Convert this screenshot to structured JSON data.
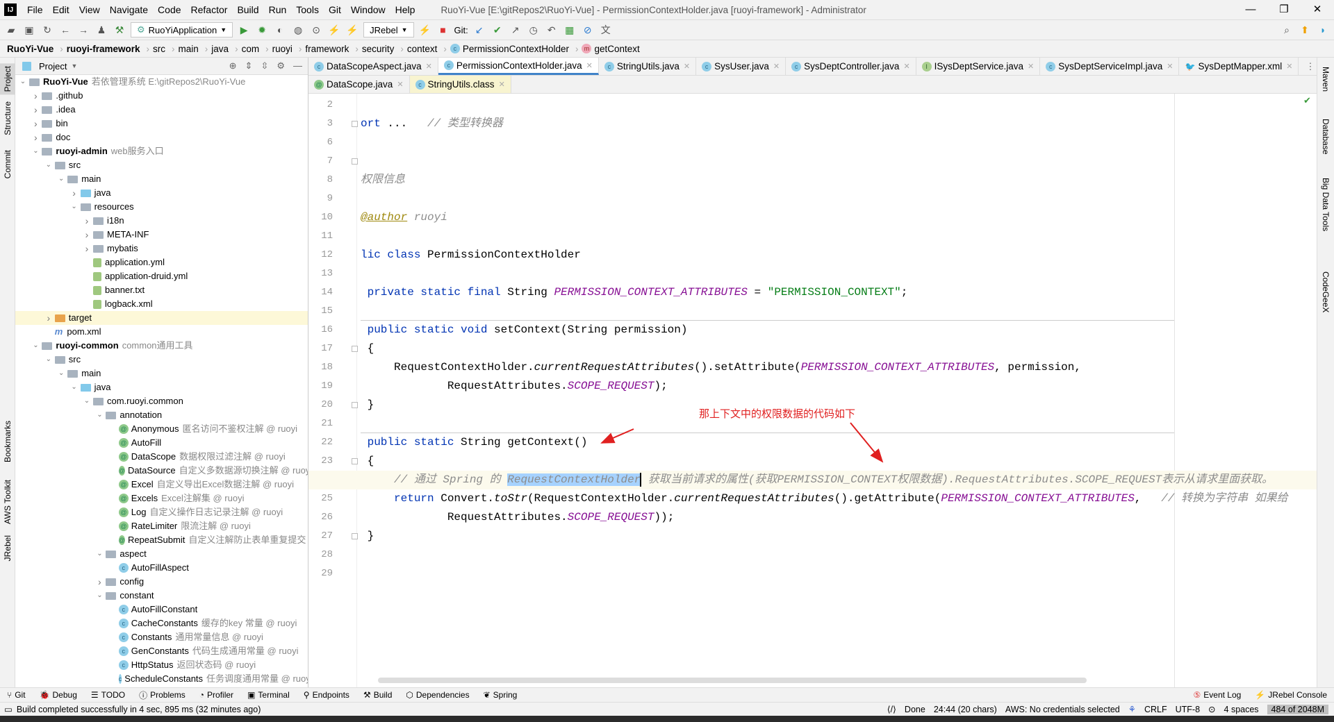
{
  "window": {
    "title": "RuoYi-Vue [E:\\gitRepos2\\RuoYi-Vue] - PermissionContextHolder.java [ruoyi-framework] - Administrator",
    "logo": "IJ",
    "controls": [
      "—",
      "❐",
      "✕"
    ]
  },
  "menu": [
    "File",
    "Edit",
    "View",
    "Navigate",
    "Code",
    "Refactor",
    "Build",
    "Run",
    "Tools",
    "Git",
    "Window",
    "Help"
  ],
  "toolbar": {
    "run_config": "RuoYiApplication",
    "jrebel": "JRebel",
    "git_label": "Git:"
  },
  "breadcrumb": [
    "RuoYi-Vue",
    "ruoyi-framework",
    "src",
    "main",
    "java",
    "com",
    "ruoyi",
    "framework",
    "security",
    "context",
    "PermissionContextHolder",
    "getContext"
  ],
  "left_stripe": [
    "Project",
    "Structure",
    "Commit",
    "Bookmarks",
    "AWS Toolkit",
    "JRebel"
  ],
  "right_stripe": [
    "Maven",
    "Database",
    "Big Data Tools",
    "CodeGeeX"
  ],
  "project": {
    "title": "Project",
    "tree": [
      {
        "l": 0,
        "a": "v",
        "i": "folder",
        "n": "RuoYi-Vue",
        "b": true,
        "h": "若依管理系统  E:\\gitRepos2\\RuoYi-Vue"
      },
      {
        "l": 1,
        "a": ">",
        "i": "folder",
        "n": ".github"
      },
      {
        "l": 1,
        "a": ">",
        "i": "folder",
        "n": ".idea"
      },
      {
        "l": 1,
        "a": ">",
        "i": "folder",
        "n": "bin"
      },
      {
        "l": 1,
        "a": ">",
        "i": "folder",
        "n": "doc"
      },
      {
        "l": 1,
        "a": "v",
        "i": "folder",
        "n": "ruoyi-admin",
        "b": true,
        "h": "web服务入口"
      },
      {
        "l": 2,
        "a": "v",
        "i": "folder",
        "n": "src"
      },
      {
        "l": 3,
        "a": "v",
        "i": "folder",
        "n": "main"
      },
      {
        "l": 4,
        "a": ">",
        "i": "blue",
        "n": "java"
      },
      {
        "l": 4,
        "a": "v",
        "i": "folder",
        "n": "resources"
      },
      {
        "l": 5,
        "a": ">",
        "i": "folder",
        "n": "i18n"
      },
      {
        "l": 5,
        "a": ">",
        "i": "folder",
        "n": "META-INF"
      },
      {
        "l": 5,
        "a": ">",
        "i": "folder",
        "n": "mybatis"
      },
      {
        "l": 5,
        "a": "",
        "i": "file",
        "n": "application.yml"
      },
      {
        "l": 5,
        "a": "",
        "i": "file",
        "n": "application-druid.yml"
      },
      {
        "l": 5,
        "a": "",
        "i": "file",
        "n": "banner.txt"
      },
      {
        "l": 5,
        "a": "",
        "i": "file",
        "n": "logback.xml"
      },
      {
        "l": 2,
        "a": ">",
        "i": "orange",
        "n": "target",
        "sel": true
      },
      {
        "l": 2,
        "a": "",
        "i": "m",
        "n": "pom.xml"
      },
      {
        "l": 1,
        "a": "v",
        "i": "folder",
        "n": "ruoyi-common",
        "b": true,
        "h": "common通用工具"
      },
      {
        "l": 2,
        "a": "v",
        "i": "folder",
        "n": "src"
      },
      {
        "l": 3,
        "a": "v",
        "i": "folder",
        "n": "main"
      },
      {
        "l": 4,
        "a": "v",
        "i": "blue",
        "n": "java"
      },
      {
        "l": 5,
        "a": "v",
        "i": "folder",
        "n": "com.ruoyi.common"
      },
      {
        "l": 6,
        "a": "v",
        "i": "folder",
        "n": "annotation"
      },
      {
        "l": 7,
        "a": "",
        "i": "@",
        "n": "Anonymous",
        "h": "匿名访问不鉴权注解 @ ruoyi"
      },
      {
        "l": 7,
        "a": "",
        "i": "@",
        "n": "AutoFill"
      },
      {
        "l": 7,
        "a": "",
        "i": "@",
        "n": "DataScope",
        "h": "数据权限过滤注解 @ ruoyi"
      },
      {
        "l": 7,
        "a": "",
        "i": "@",
        "n": "DataSource",
        "h": "自定义多数据源切换注解 @ ruoyi"
      },
      {
        "l": 7,
        "a": "",
        "i": "@",
        "n": "Excel",
        "h": "自定义导出Excel数据注解 @ ruoyi"
      },
      {
        "l": 7,
        "a": "",
        "i": "@",
        "n": "Excels",
        "h": "Excel注解集 @ ruoyi"
      },
      {
        "l": 7,
        "a": "",
        "i": "@",
        "n": "Log",
        "h": "自定义操作日志记录注解 @ ruoyi"
      },
      {
        "l": 7,
        "a": "",
        "i": "@",
        "n": "RateLimiter",
        "h": "限流注解 @ ruoyi"
      },
      {
        "l": 7,
        "a": "",
        "i": "@",
        "n": "RepeatSubmit",
        "h": "自定义注解防止表单重复提交 @"
      },
      {
        "l": 6,
        "a": "v",
        "i": "folder",
        "n": "aspect"
      },
      {
        "l": 7,
        "a": "",
        "i": "c",
        "n": "AutoFillAspect"
      },
      {
        "l": 6,
        "a": ">",
        "i": "folder",
        "n": "config"
      },
      {
        "l": 6,
        "a": "v",
        "i": "folder",
        "n": "constant"
      },
      {
        "l": 7,
        "a": "",
        "i": "c",
        "n": "AutoFillConstant"
      },
      {
        "l": 7,
        "a": "",
        "i": "c",
        "n": "CacheConstants",
        "h": "缓存的key 常量 @ ruoyi"
      },
      {
        "l": 7,
        "a": "",
        "i": "c",
        "n": "Constants",
        "h": "通用常量信息 @ ruoyi"
      },
      {
        "l": 7,
        "a": "",
        "i": "c",
        "n": "GenConstants",
        "h": "代码生成通用常量 @ ruoyi"
      },
      {
        "l": 7,
        "a": "",
        "i": "c",
        "n": "HttpStatus",
        "h": "返回状态码 @ ruoyi"
      },
      {
        "l": 7,
        "a": "",
        "i": "c",
        "n": "ScheduleConstants",
        "h": "任务调度通用常量 @ ruoy"
      }
    ]
  },
  "tabs_row1": [
    {
      "icon": "c",
      "label": "DataScopeAspect.java"
    },
    {
      "icon": "c",
      "label": "PermissionContextHolder.java",
      "active": true
    },
    {
      "icon": "c",
      "label": "StringUtils.java"
    },
    {
      "icon": "c",
      "label": "SysUser.java"
    },
    {
      "icon": "c",
      "label": "SysDeptController.java"
    },
    {
      "icon": "i",
      "label": "ISysDeptService.java"
    },
    {
      "icon": "c",
      "label": "SysDeptServiceImpl.java"
    },
    {
      "icon": "xml",
      "label": "SysDeptMapper.xml"
    }
  ],
  "tabs_row2": [
    {
      "icon": "@",
      "label": "DataScope.java"
    },
    {
      "icon": "c",
      "label": "StringUtils.class",
      "yellow": true
    }
  ],
  "code": [
    {
      "n": 2,
      "t": []
    },
    {
      "n": 3,
      "t": [
        [
          "kw",
          "ort "
        ],
        [
          "",
          "... "
        ],
        [
          "",
          "  "
        ],
        [
          "cmt",
          "// 类型转换器"
        ]
      ]
    },
    {
      "n": 6,
      "t": []
    },
    {
      "n": 7,
      "t": []
    },
    {
      "n": 8,
      "t": [
        [
          "cmt",
          "权限信息"
        ]
      ]
    },
    {
      "n": 9,
      "t": []
    },
    {
      "n": 10,
      "t": [
        [
          "ann",
          "@author"
        ],
        [
          "cmt",
          " ruoyi"
        ]
      ]
    },
    {
      "n": 11,
      "t": []
    },
    {
      "n": 12,
      "t": [
        [
          "kw",
          "lic class "
        ],
        [
          "",
          "PermissionContextHolder"
        ]
      ]
    },
    {
      "n": 13,
      "t": []
    },
    {
      "n": 14,
      "t": [
        [
          "kw",
          " private static final "
        ],
        [
          "",
          "String "
        ],
        [
          "fld",
          "PERMISSION_CONTEXT_ATTRIBUTES"
        ],
        [
          "",
          " = "
        ],
        [
          "str",
          "\"PERMISSION_CONTEXT\""
        ],
        [
          "",
          ";"
        ]
      ]
    },
    {
      "n": 15,
      "t": []
    },
    {
      "n": 16,
      "t": [
        [
          "kw",
          " public static void "
        ],
        [
          "",
          "setContext(String permission)"
        ]
      ]
    },
    {
      "n": 17,
      "t": [
        [
          "",
          " {"
        ]
      ]
    },
    {
      "n": 18,
      "t": [
        [
          "",
          "     RequestContextHolder."
        ],
        [
          "st",
          "currentRequestAttributes"
        ],
        [
          "",
          "().setAttribute("
        ],
        [
          "fld",
          "PERMISSION_CONTEXT_ATTRIBUTES"
        ],
        [
          "",
          ", permission,"
        ]
      ]
    },
    {
      "n": 19,
      "t": [
        [
          "",
          "             RequestAttributes."
        ],
        [
          "fld",
          "SCOPE_REQUEST"
        ],
        [
          "",
          ");"
        ]
      ]
    },
    {
      "n": 20,
      "t": [
        [
          "",
          " }"
        ]
      ]
    },
    {
      "n": 21,
      "t": []
    },
    {
      "n": 22,
      "t": [
        [
          "kw",
          " public static "
        ],
        [
          "",
          "String getContext()"
        ]
      ]
    },
    {
      "n": 23,
      "t": [
        [
          "",
          " {"
        ]
      ]
    },
    {
      "n": 24,
      "t": [
        [
          "cmt",
          "     // 通过 Spring 的 "
        ],
        [
          "cmt selw",
          "RequestContextHolder"
        ],
        [
          "cmt",
          " 获取当前请求的属性(获取PERMISSION_CONTEXT权限数据).RequestAttributes.SCOPE_REQUEST表示从请求里面获取。"
        ]
      ],
      "current": true
    },
    {
      "n": 25,
      "t": [
        [
          "kw",
          "     return "
        ],
        [
          "",
          "Convert."
        ],
        [
          "st",
          "toStr"
        ],
        [
          "",
          "(RequestContextHolder."
        ],
        [
          "st",
          "currentRequestAttributes"
        ],
        [
          "",
          "().getAttribute("
        ],
        [
          "fld",
          "PERMISSION_CONTEXT_ATTRIBUTES"
        ],
        [
          "",
          ",   "
        ],
        [
          "cmt",
          "// 转换为字符串 如果给"
        ]
      ]
    },
    {
      "n": 26,
      "t": [
        [
          "",
          "             RequestAttributes."
        ],
        [
          "fld",
          "SCOPE_REQUEST"
        ],
        [
          "",
          "));"
        ]
      ]
    },
    {
      "n": 27,
      "t": [
        [
          "",
          " }"
        ]
      ]
    },
    {
      "n": 28,
      "t": []
    },
    {
      "n": 29,
      "t": []
    }
  ],
  "annotation": {
    "text": "那上下文中的权限数据的代码如下",
    "color": "#e02020"
  },
  "bottom_tools": [
    "Git",
    "Debug",
    "TODO",
    "Problems",
    "Profiler",
    "Terminal",
    "Endpoints",
    "Build",
    "Dependencies",
    "Spring"
  ],
  "bottom_right": [
    "Event Log",
    "JRebel Console"
  ],
  "status": {
    "message": "Build completed successfully in 4 sec, 895 ms (32 minutes ago)",
    "done": "Done",
    "position": "24:44 (20 chars)",
    "aws": "AWS: No credentials selected",
    "line_sep": "CRLF",
    "encoding": "UTF-8",
    "indent": "4 spaces",
    "memory": "484 of 2048M"
  },
  "colors": {
    "accent": "#4083c9",
    "keyword": "#0033b3",
    "field": "#871094",
    "string": "#067d17",
    "comment": "#8c8c8c",
    "selection": "#a6d2ff",
    "annotation_red": "#e02020"
  }
}
